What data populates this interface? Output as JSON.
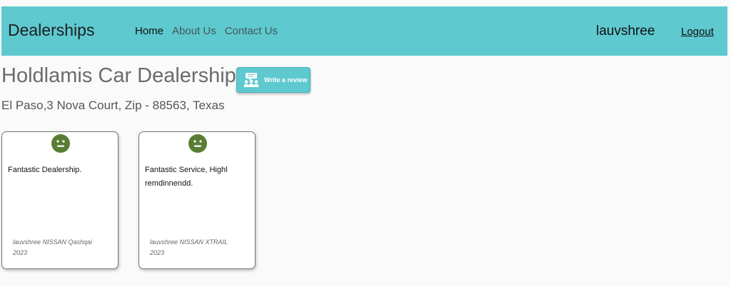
{
  "navbar": {
    "brand": "Dealerships",
    "links": [
      {
        "label": "Home"
      },
      {
        "label": "About Us"
      },
      {
        "label": "Contact Us"
      }
    ],
    "username": "lauvshree",
    "logout_label": "Logout",
    "background_color": "#5ec9cf"
  },
  "dealer": {
    "name": "Holdlamis Car Dealership",
    "address": "El Paso,3 Nova Court, Zip - 88563, Texas"
  },
  "write_review": {
    "label": "Write a review",
    "icon": "review-people-icon"
  },
  "reviews": [
    {
      "sentiment": "positive",
      "sentiment_icon": "smiley-face-icon",
      "text": "Fantastic Dealership.",
      "reviewer_car": "lauvshree NISSAN Qashqai",
      "year": "2023"
    },
    {
      "sentiment": "positive",
      "sentiment_icon": "smiley-face-icon",
      "text": "Fantastic Service, Highl remdinnendd.",
      "reviewer_car": "lauvshree NISSAN XTRAIL",
      "year": "2023"
    }
  ]
}
